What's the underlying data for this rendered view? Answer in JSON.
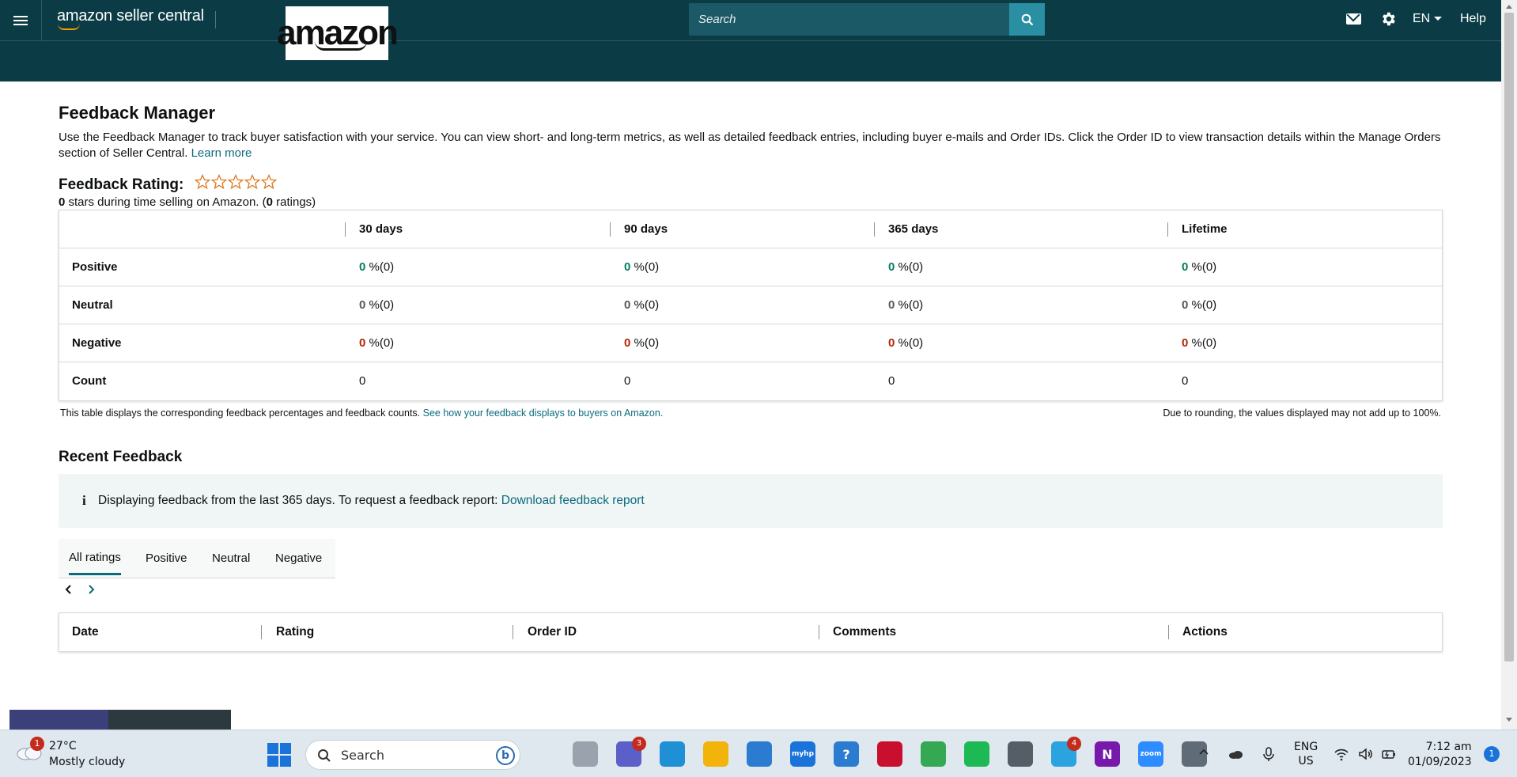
{
  "header": {
    "brand": "amazon seller central",
    "logo_text": "amazon",
    "search_placeholder": "Search",
    "language": "EN",
    "help": "Help"
  },
  "page": {
    "title": "Feedback Manager",
    "intro": "Use the Feedback Manager to track buyer satisfaction with your service. You can view short- and long-term metrics, as well as detailed feedback entries, including buyer e-mails and Order IDs. Click the Order ID to view transaction details within the Manage Orders section of Seller Central.",
    "learn_more": "Learn more",
    "rating_label": "Feedback Rating:",
    "star_count": 0,
    "star_max": 5,
    "rating_stars_value": "0",
    "rating_stars_text": " stars during time selling on Amazon. (",
    "rating_count_value": "0",
    "rating_count_text": " ratings)"
  },
  "feedback_table": {
    "headers": [
      "",
      "30 days",
      "90 days",
      "365 days",
      "Lifetime"
    ],
    "rows": [
      {
        "label": "Positive",
        "cells": [
          [
            "0",
            " %(0)"
          ],
          [
            "0",
            " %(0)"
          ],
          [
            "0",
            " %(0)"
          ],
          [
            "0",
            " %(0)"
          ]
        ]
      },
      {
        "label": "Neutral",
        "cells": [
          [
            "0",
            " %(0)"
          ],
          [
            "0",
            " %(0)"
          ],
          [
            "0",
            " %(0)"
          ],
          [
            "0",
            " %(0)"
          ]
        ]
      },
      {
        "label": "Negative",
        "cells": [
          [
            "0",
            " %(0)"
          ],
          [
            "0",
            " %(0)"
          ],
          [
            "0",
            " %(0)"
          ],
          [
            "0",
            " %(0)"
          ]
        ]
      },
      {
        "label": "Count",
        "cells": [
          [
            "",
            "0"
          ],
          [
            "",
            "0"
          ],
          [
            "",
            "0"
          ],
          [
            "",
            "0"
          ]
        ]
      }
    ],
    "note": "This table displays the corresponding feedback percentages and feedback counts.",
    "note_link": "See how your feedback displays to buyers on Amazon.",
    "note_right": "Due to rounding, the values displayed may not add up to 100%.",
    "colors": {
      "positive": "#067d62",
      "neutral": "#565959",
      "negative": "#b12704"
    }
  },
  "recent": {
    "title": "Recent Feedback",
    "info_icon": "i",
    "info_text": "Displaying feedback from the last 365 days. To request a feedback report:",
    "info_link": "Download feedback report",
    "tabs": [
      "All ratings",
      "Positive",
      "Neutral",
      "Negative"
    ],
    "active_tab": "All ratings",
    "columns": [
      "Date",
      "Rating",
      "Order ID",
      "Comments",
      "Actions"
    ]
  },
  "taskbar": {
    "weather_badge": "1",
    "temperature": "27°C",
    "condition": "Mostly cloudy",
    "search": "Search",
    "apps": [
      {
        "name": "task-view",
        "color": "#9aa3ad",
        "label": ""
      },
      {
        "name": "teams",
        "color": "#5b5fc7",
        "label": "",
        "badge": "3"
      },
      {
        "name": "edge",
        "color": "#1f8fd6",
        "label": ""
      },
      {
        "name": "file-explorer",
        "color": "#f2b40a",
        "label": ""
      },
      {
        "name": "microsoft-store",
        "color": "#2b7bd1",
        "label": ""
      },
      {
        "name": "myhp",
        "color": "#1a73d9",
        "label": "myhp"
      },
      {
        "name": "get-help",
        "color": "#2b7bd1",
        "label": "?"
      },
      {
        "name": "mcafee",
        "color": "#c8102e",
        "label": ""
      },
      {
        "name": "chrome",
        "color": "#34a853",
        "label": ""
      },
      {
        "name": "spotify",
        "color": "#1db954",
        "label": ""
      },
      {
        "name": "calculator",
        "color": "#555d66",
        "label": ""
      },
      {
        "name": "telegram",
        "color": "#2aa3df",
        "label": "",
        "badge": "4"
      },
      {
        "name": "onenote",
        "color": "#7719aa",
        "label": "N"
      },
      {
        "name": "zoom",
        "color": "#2d8cff",
        "label": "zoom"
      },
      {
        "name": "snipping-tool",
        "color": "#5f6b77",
        "label": ""
      }
    ],
    "lang_line1": "ENG",
    "lang_line2": "US",
    "time": "7:12 am",
    "date": "01/09/2023",
    "notification_count": "1"
  }
}
